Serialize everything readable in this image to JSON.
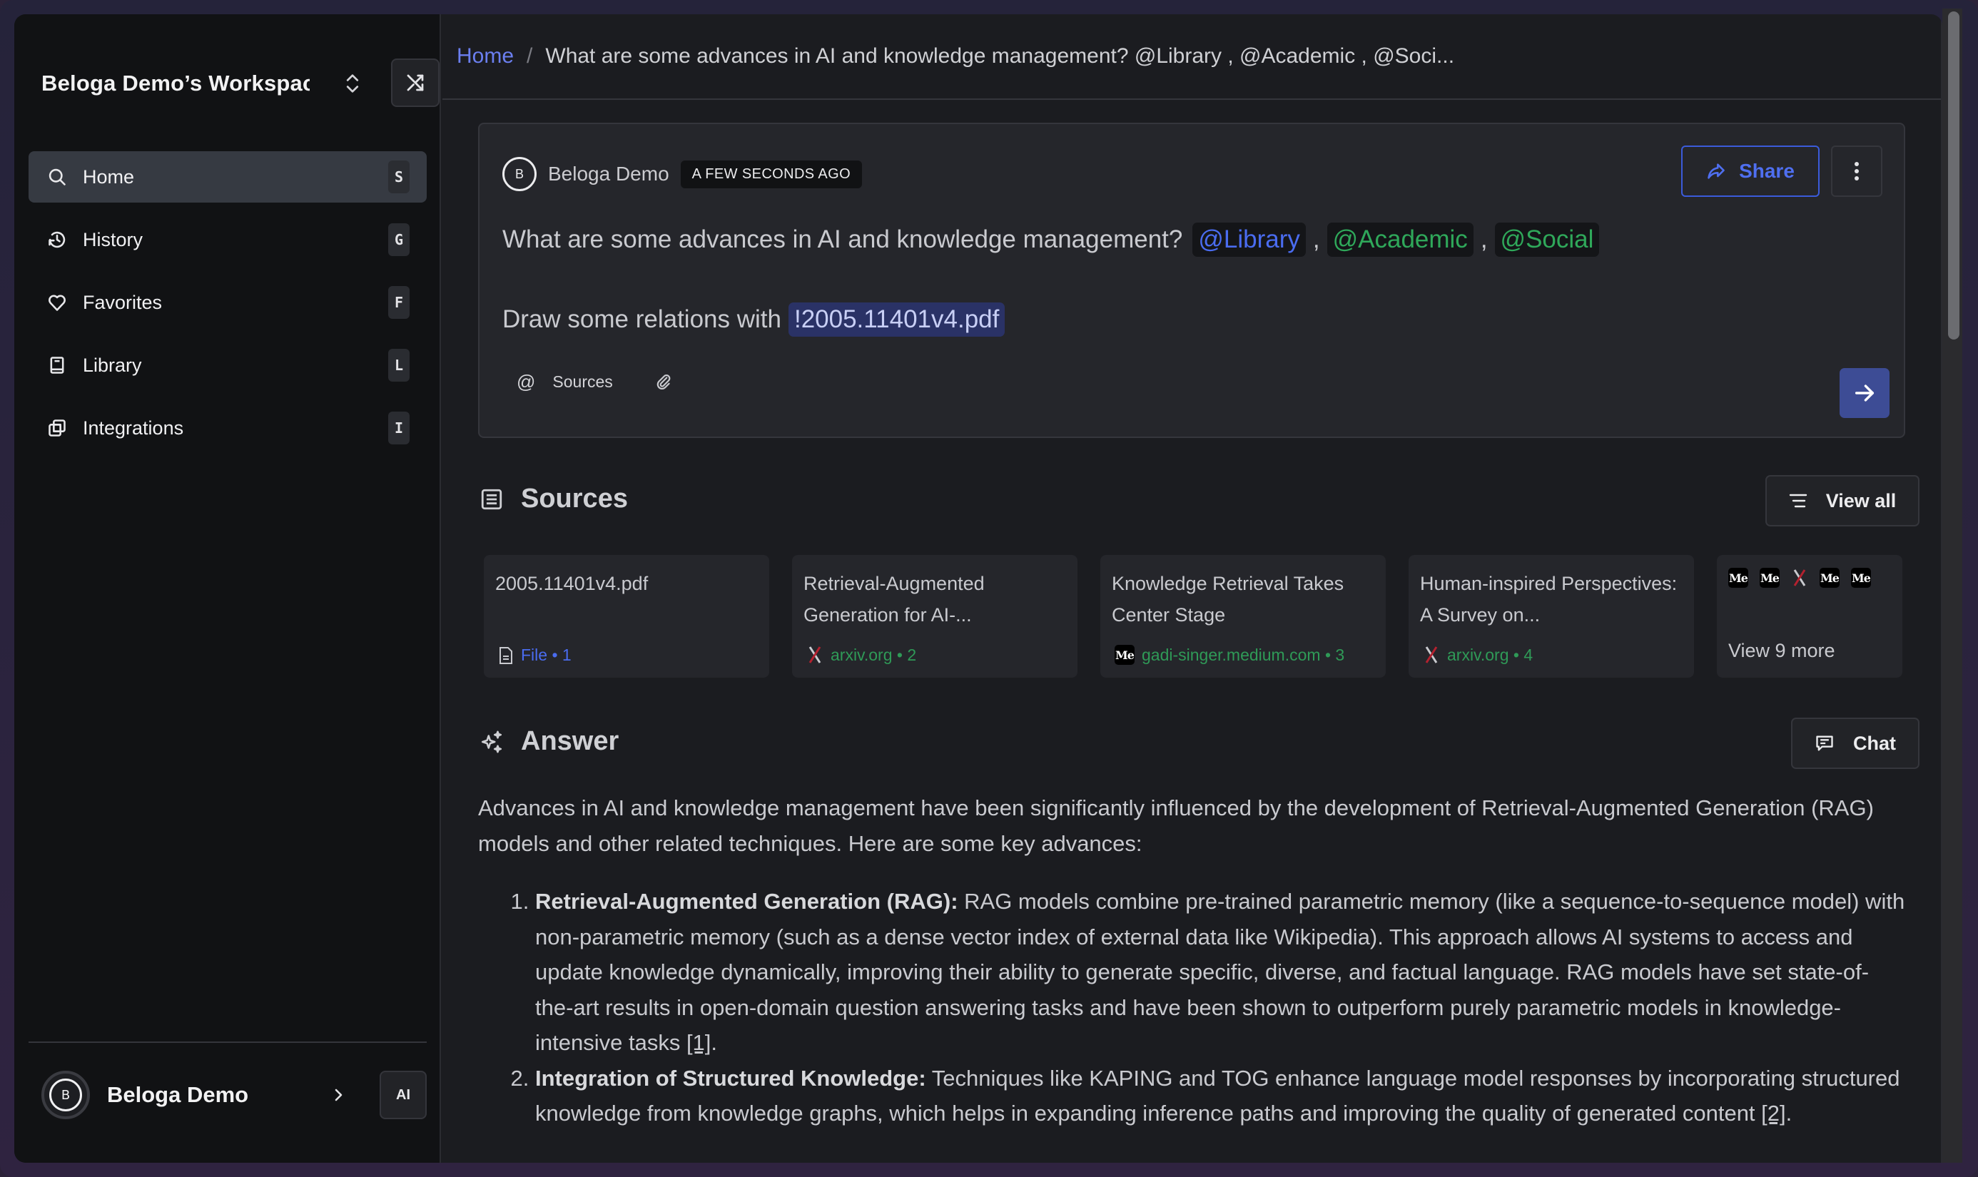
{
  "sidebar": {
    "workspace_name": "Beloga Demo’s Workspace",
    "nav": [
      {
        "label": "Home",
        "key": "S",
        "icon": "search-icon",
        "active": true
      },
      {
        "label": "History",
        "key": "G",
        "icon": "history-icon",
        "active": false
      },
      {
        "label": "Favorites",
        "key": "F",
        "icon": "heart-icon",
        "active": false
      },
      {
        "label": "Library",
        "key": "L",
        "icon": "book-icon",
        "active": false
      },
      {
        "label": "Integrations",
        "key": "I",
        "icon": "integrations-icon",
        "active": false
      }
    ],
    "user": {
      "name": "Beloga Demo",
      "avatar_letter": "B",
      "badge": "AI"
    }
  },
  "breadcrumb": {
    "home": "Home",
    "separator": "/",
    "current": "What are some advances in AI and knowledge management? @Library , @Academic , @Soci..."
  },
  "query": {
    "user": "Beloga Demo",
    "avatar_letter": "B",
    "time": "A FEW SECONDS AGO",
    "share_label": "Share",
    "line1_text": "What are some advances in AI and knowledge management?",
    "mentions": [
      {
        "label": "@Library",
        "color": "#4a6cf0"
      },
      {
        "label": "@Academic",
        "color": "#2fa85a"
      },
      {
        "label": "@Social",
        "color": "#2fa85a"
      }
    ],
    "line2_text": "Draw some relations with",
    "file_ref": "!2005.11401v4.pdf",
    "sources_label": "Sources"
  },
  "sources": {
    "title": "Sources",
    "view_all": "View all",
    "cards": [
      {
        "title": "2005.11401v4.pdf",
        "meta": "File • 1",
        "kind": "file"
      },
      {
        "title": "Retrieval-Augmented Generation for AI-...",
        "meta": "arxiv.org • 2",
        "kind": "arxiv"
      },
      {
        "title": "Knowledge Retrieval Takes Center Stage",
        "meta": "gadi-singer.medium.com • 3",
        "kind": "medium"
      },
      {
        "title": "Human-inspired Perspectives: A Survey on...",
        "meta": "arxiv.org • 4",
        "kind": "arxiv"
      }
    ],
    "more_label": "View 9 more",
    "more_favicon_label": "Me"
  },
  "answer": {
    "title": "Answer",
    "chat_label": "Chat",
    "intro": "Advances in AI and knowledge management have been significantly influenced by the development of Retrieval-Augmented Generation (RAG) models and other related techniques. Here are some key advances:",
    "items": [
      {
        "heading": "Retrieval-Augmented Generation (RAG):",
        "text": " RAG models combine pre-trained parametric memory (like a sequence-to-sequence model) with non-parametric memory (such as a dense vector index of external data like Wikipedia). This approach allows AI systems to access and update knowledge dynamically, improving their ability to generate specific, diverse, and factual language. RAG models have set state-of-the-art results in open-domain question answering tasks and have been shown to outperform purely parametric models in knowledge-intensive tasks ",
        "cite": "[1]",
        "end": "."
      },
      {
        "heading": "Integration of Structured Knowledge:",
        "text": " Techniques like KAPING and TOG enhance language model responses by incorporating structured knowledge from knowledge graphs, which helps in expanding inference paths and improving the quality of generated content ",
        "cite": "[2]",
        "end": "."
      }
    ]
  },
  "colors": {
    "accent_blue": "#4a6cf0",
    "accent_green": "#2fa85a",
    "send_button": "#3d4c95",
    "sidebar_bg": "#111214",
    "main_bg": "#1b1c20"
  }
}
